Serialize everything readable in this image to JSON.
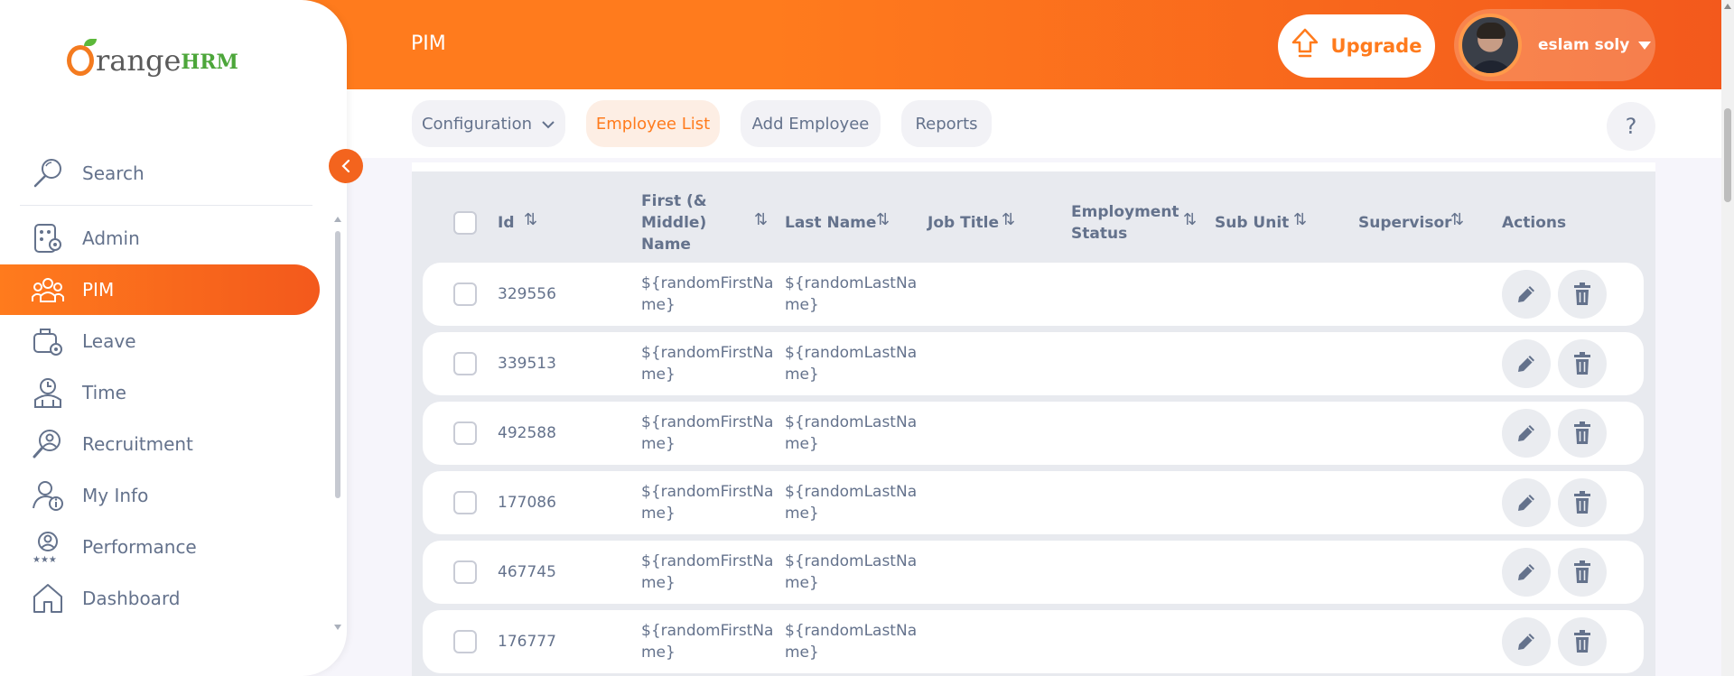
{
  "header": {
    "title": "PIM",
    "upgrade_label": "Upgrade",
    "user_name": "eslam soly"
  },
  "subnav": {
    "items": [
      {
        "label": "Configuration",
        "active": false,
        "has_dropdown": true
      },
      {
        "label": "Employee List",
        "active": true,
        "has_dropdown": false
      },
      {
        "label": "Add Employee",
        "active": false,
        "has_dropdown": false
      },
      {
        "label": "Reports",
        "active": false,
        "has_dropdown": false
      }
    ],
    "help_label": "?"
  },
  "logo": {
    "part1": "range",
    "part2": "HRM"
  },
  "sidebar": {
    "search_label": "Search",
    "items": [
      {
        "label": "Admin",
        "icon": "admin-icon"
      },
      {
        "label": "PIM",
        "icon": "pim-icon",
        "active": true
      },
      {
        "label": "Leave",
        "icon": "leave-icon"
      },
      {
        "label": "Time",
        "icon": "time-icon"
      },
      {
        "label": "Recruitment",
        "icon": "recruitment-icon"
      },
      {
        "label": "My Info",
        "icon": "my-info-icon"
      },
      {
        "label": "Performance",
        "icon": "performance-icon"
      },
      {
        "label": "Dashboard",
        "icon": "dashboard-icon"
      }
    ]
  },
  "table": {
    "headers": {
      "id": "Id",
      "first_name_l1": "First (&",
      "first_name_l2": "Middle)",
      "first_name_l3": "Name",
      "last_name": "Last Name",
      "job_title": "Job Title",
      "employment_status_l1": "Employment",
      "employment_status_l2": "Status",
      "sub_unit": "Sub Unit",
      "supervisor": "Supervisor",
      "actions": "Actions"
    },
    "rows": [
      {
        "id": "329556",
        "first_l1": "${randomFirstNa",
        "first_l2": "me}",
        "last_l1": "${randomLastNa",
        "last_l2": "me}"
      },
      {
        "id": "339513",
        "first_l1": "${randomFirstNa",
        "first_l2": "me}",
        "last_l1": "${randomLastNa",
        "last_l2": "me}"
      },
      {
        "id": "492588",
        "first_l1": "${randomFirstNa",
        "first_l2": "me}",
        "last_l1": "${randomLastNa",
        "last_l2": "me}"
      },
      {
        "id": "177086",
        "first_l1": "${randomFirstNa",
        "first_l2": "me}",
        "last_l1": "${randomLastNa",
        "last_l2": "me}"
      },
      {
        "id": "467745",
        "first_l1": "${randomFirstNa",
        "first_l2": "me}",
        "last_l1": "${randomLastNa",
        "last_l2": "me}"
      },
      {
        "id": "176777",
        "first_l1": "${randomFirstNa",
        "first_l2": "me}",
        "last_l1": "${randomLastNa",
        "last_l2": "me}"
      }
    ]
  },
  "colors": {
    "accent": "#ff7b1d",
    "accent_dark": "#f3591c",
    "text": "#64728c"
  }
}
